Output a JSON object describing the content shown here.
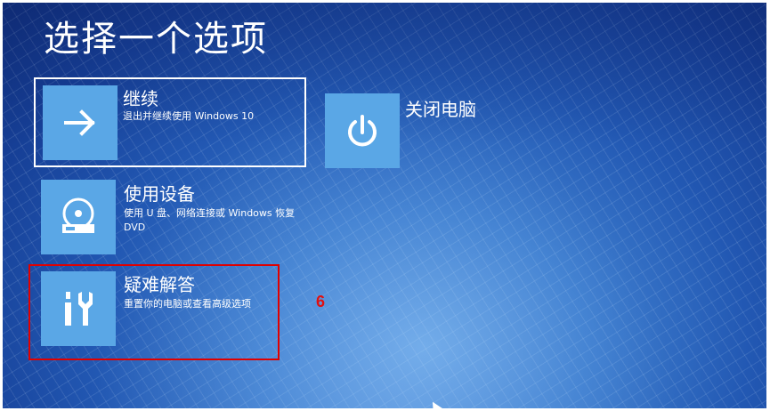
{
  "page": {
    "title": "选择一个选项"
  },
  "options": {
    "continue": {
      "label": "继续",
      "description": "退出并继续使用 Windows 10",
      "icon": "arrow-right-icon"
    },
    "use_device": {
      "label": "使用设备",
      "description": "使用 U 盘、网络连接或 Windows 恢复 DVD",
      "icon": "disc-drive-icon"
    },
    "troubleshoot": {
      "label": "疑难解答",
      "description": "重置你的电脑或查看高级选项",
      "icon": "tools-icon"
    },
    "shutdown": {
      "label": "关闭电脑",
      "icon": "power-icon"
    }
  },
  "annotation": {
    "step_number": "6",
    "highlight_color": "#e00000"
  },
  "colors": {
    "tile": "#5aa7e6",
    "background": "#1f4fa8",
    "text": "#ffffff"
  }
}
